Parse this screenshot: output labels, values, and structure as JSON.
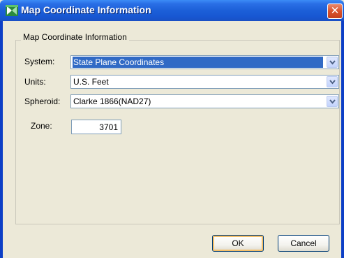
{
  "window": {
    "title": "Map Coordinate Information"
  },
  "group": {
    "legend": "Map Coordinate Information"
  },
  "fields": {
    "system": {
      "label": "System:",
      "value": "State Plane Coordinates"
    },
    "units": {
      "label": "Units:",
      "value": "U.S. Feet"
    },
    "spheroid": {
      "label": "Spheroid:",
      "value": "Clarke 1866(NAD27)"
    },
    "zone": {
      "label": "Zone:",
      "value": "3701"
    }
  },
  "buttons": {
    "ok": "OK",
    "cancel": "Cancel"
  },
  "colors": {
    "titlebar": "#1c5fd8",
    "selection": "#316ac5",
    "dialog_bg": "#ece9d8",
    "close": "#d9512c"
  },
  "icons": {
    "app": "map-coordinate-app-icon",
    "close": "close-icon",
    "dropdown": "chevron-down-icon"
  }
}
